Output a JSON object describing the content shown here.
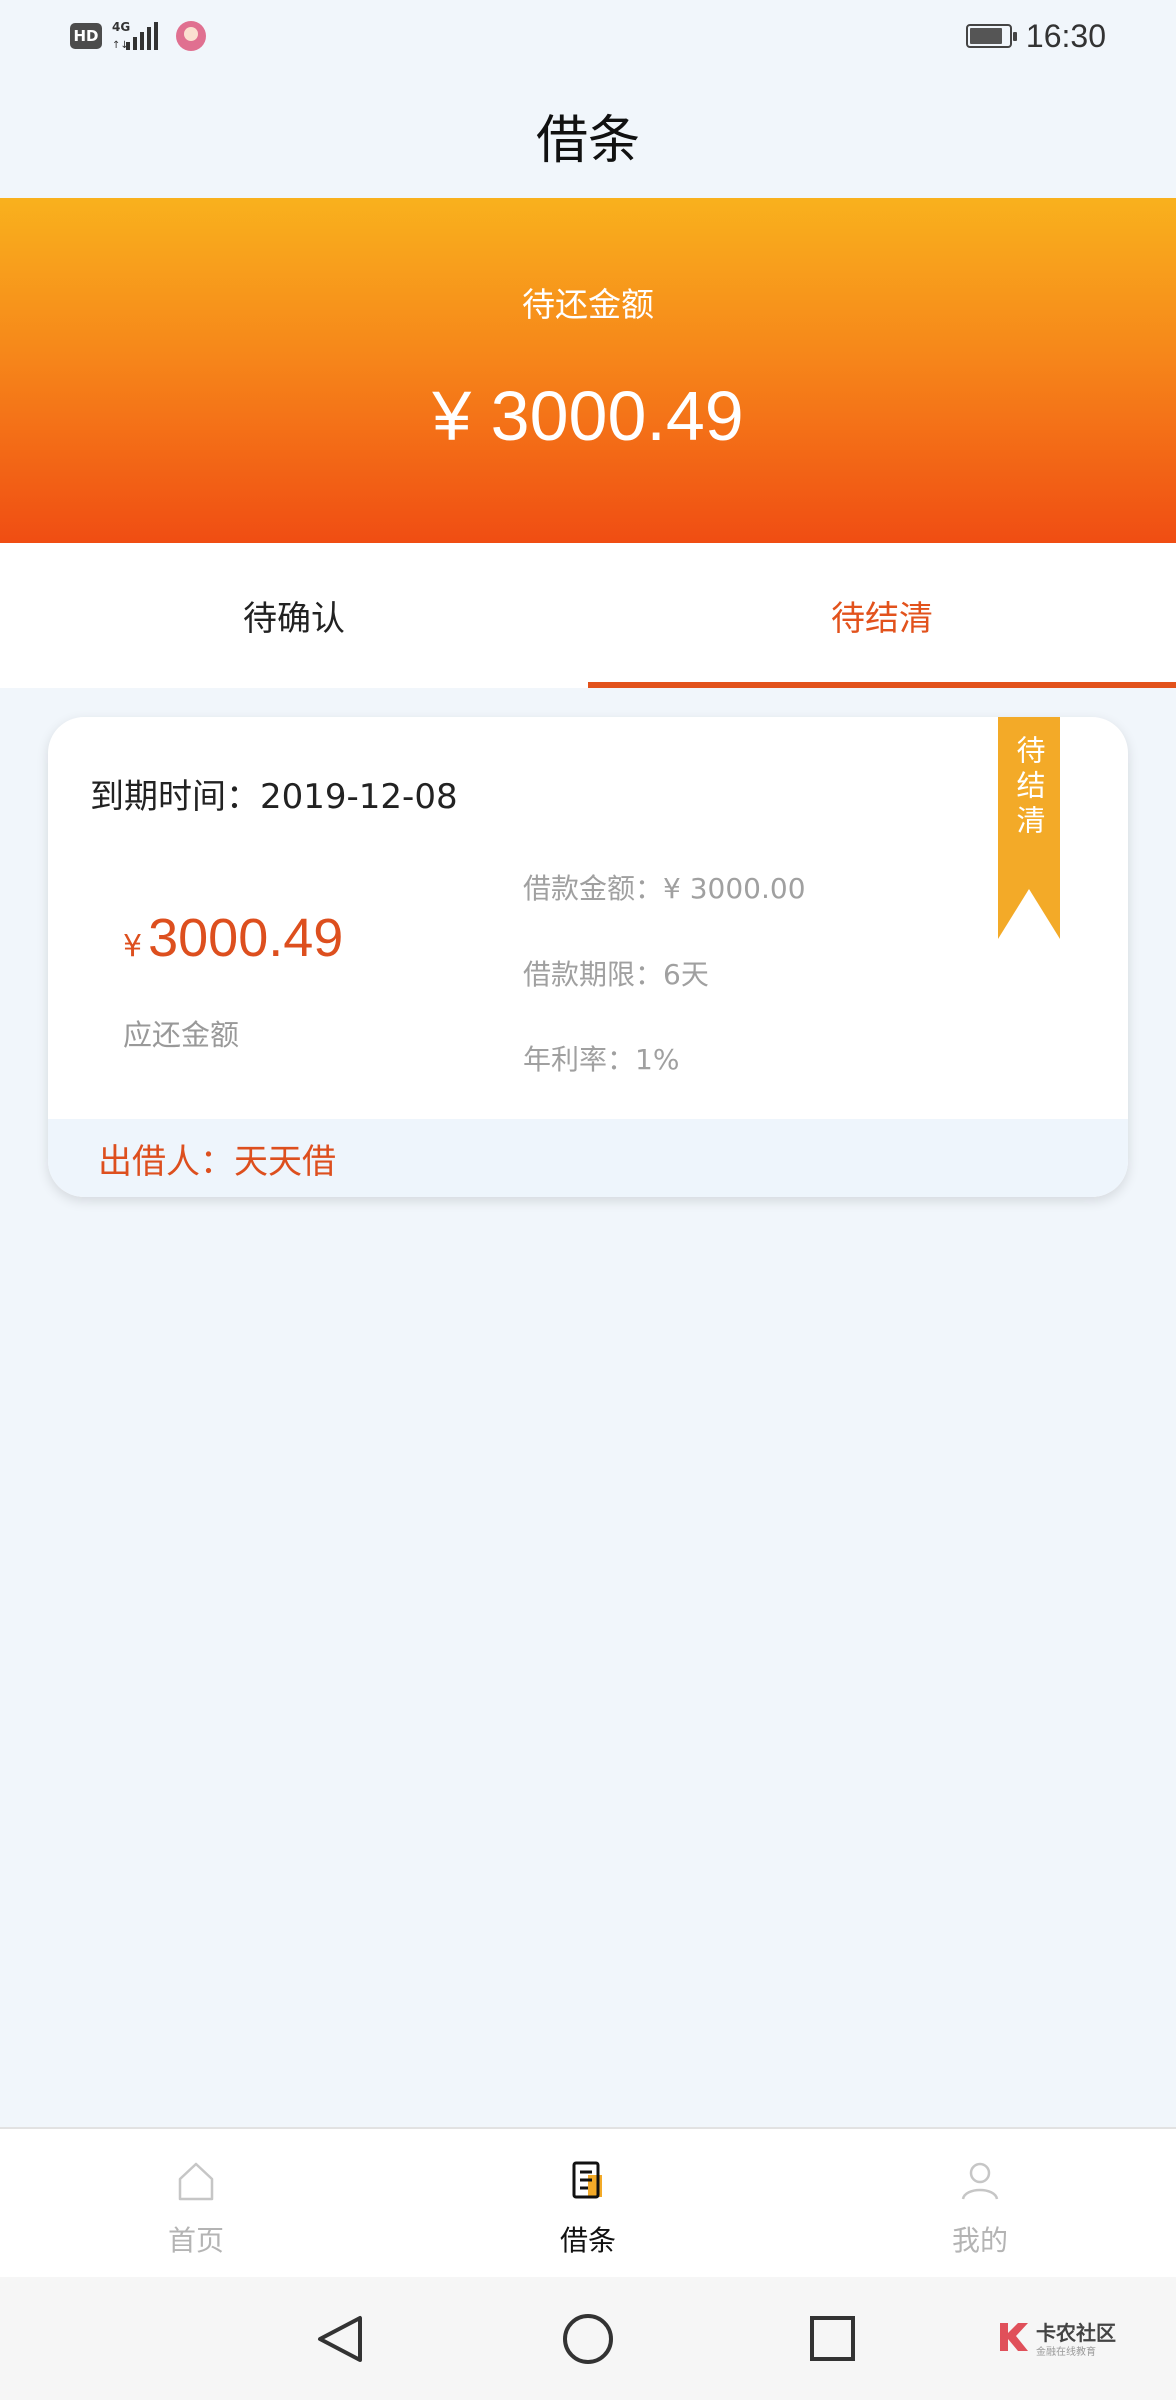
{
  "status_bar": {
    "hd": "HD",
    "network": "4G",
    "battery_level": 0.85,
    "time": "16:30"
  },
  "header": {
    "title": "借条"
  },
  "hero": {
    "label": "待还金额",
    "amount": "¥ 3000.49"
  },
  "tabs": [
    {
      "label": "待确认",
      "active": false
    },
    {
      "label": "待结清",
      "active": true
    }
  ],
  "loan_card": {
    "due_date": "到期时间：2019-12-08",
    "currency_symbol": "¥",
    "amount_due": "3000.49",
    "amount_due_label": "应还金额",
    "loan_amount": "借款金额：¥ 3000.00",
    "loan_term": "借款期限：6天",
    "annual_rate": "年利率：1%",
    "lender": "出借人：天天借",
    "ribbon_status": "待结清"
  },
  "bottom_nav": {
    "items": [
      {
        "label": "首页",
        "icon": "home-icon",
        "active": false
      },
      {
        "label": "借条",
        "icon": "document-icon",
        "active": true
      },
      {
        "label": "我的",
        "icon": "profile-icon",
        "active": false
      }
    ]
  },
  "watermark": {
    "title": "卡农社区",
    "subtitle": "金融在线教育"
  },
  "colors": {
    "accent": "#e2521c",
    "hero_top": "#f9b11d",
    "hero_bottom": "#f04d13",
    "ribbon": "#f3aa28",
    "background": "#f1f6fb"
  }
}
